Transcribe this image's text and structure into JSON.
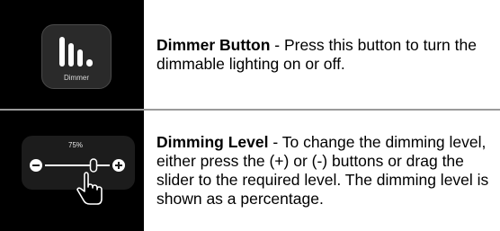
{
  "dimmer_button": {
    "icon_label": "Dimmer",
    "title": "Dimmer Button",
    "description": " - Press this button to turn the dimmable lighting on or off."
  },
  "dimming_level": {
    "percent_label": "75%",
    "level": 0.75,
    "title": "Dimming Level",
    "description": " - To change the dimming level, either press the (+) or (-) buttons or drag the slider to the required level.  The dimming level is shown as a percentage."
  },
  "icons": [
    "dimmer-bars-icon",
    "minus-icon",
    "plus-icon",
    "hand-pointer-icon"
  ],
  "colors": {
    "thumb_bg": "#000000",
    "icon_fg": "#ffffff",
    "divider": "#9a9a9a"
  }
}
